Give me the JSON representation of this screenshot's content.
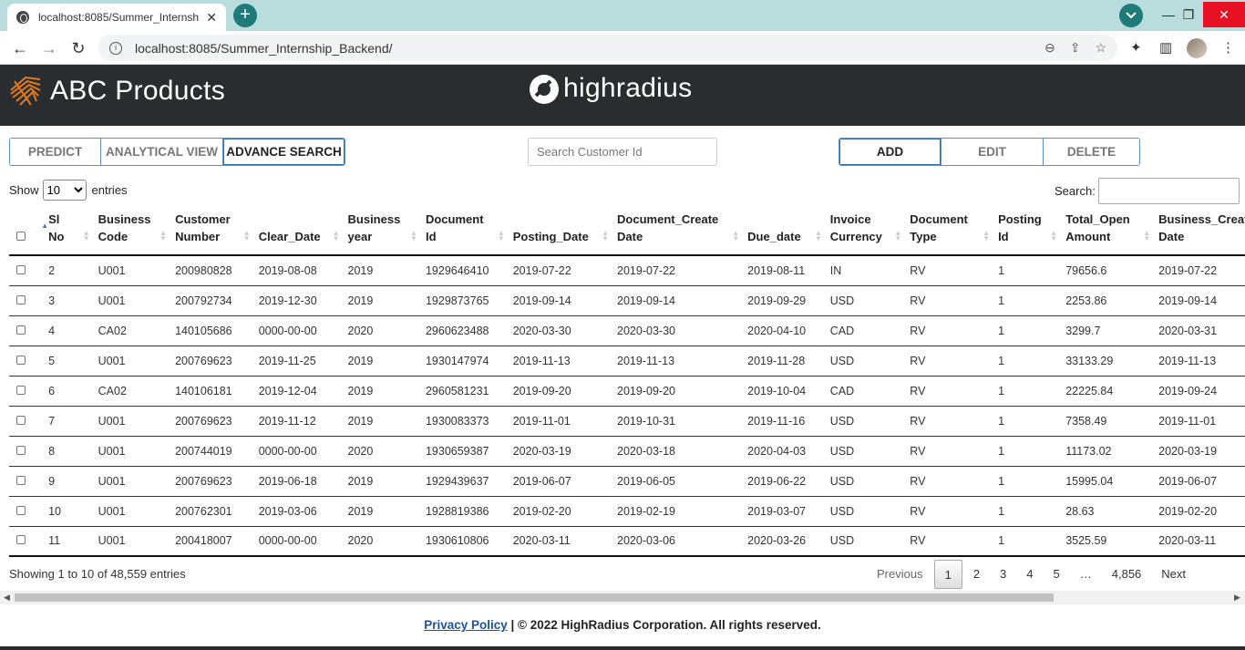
{
  "browser": {
    "tab_title": "localhost:8085/Summer_Internsh",
    "new_tab": "+",
    "tab_close": "✕",
    "url": "localhost:8085/Summer_Internship_Backend/",
    "window_controls": {
      "minimize": "—",
      "maximize": "❐",
      "close": "✕"
    }
  },
  "header": {
    "app_title": "ABC Products",
    "brand": "highradius",
    "colors": {
      "bar": "#2a2d2f",
      "logo_accent": "#e07a22"
    }
  },
  "left_buttons": [
    {
      "label": "PREDICT"
    },
    {
      "label": "ANALYTICAL VIEW"
    },
    {
      "label": "ADVANCE SEARCH"
    }
  ],
  "search": {
    "placeholder": "Search Customer Id"
  },
  "right_buttons": [
    {
      "label": "ADD"
    },
    {
      "label": "EDIT"
    },
    {
      "label": "DELETE"
    }
  ],
  "length_menu": {
    "prefix": "Show",
    "value": "10",
    "suffix": "entries"
  },
  "filter": {
    "label": "Search:"
  },
  "table": {
    "columns": [
      {
        "label": "Sl\nNo"
      },
      {
        "label": "Business\nCode"
      },
      {
        "label": "Customer\nNumber"
      },
      {
        "label": "Clear_Date"
      },
      {
        "label": "Business\nyear"
      },
      {
        "label": "Document\nId"
      },
      {
        "label": "Posting_Date"
      },
      {
        "label": "Document_Create\nDate"
      },
      {
        "label": "Due_date"
      },
      {
        "label": "Invoice\nCurrency"
      },
      {
        "label": "Document\nType"
      },
      {
        "label": "Posting\nId"
      },
      {
        "label": "Total_Open\nAmount"
      },
      {
        "label": "Business_Create\nDate"
      }
    ],
    "rows": [
      [
        "2",
        "U001",
        "200980828",
        "2019-08-08",
        "2019",
        "1929646410",
        "2019-07-22",
        "2019-07-22",
        "2019-08-11",
        "IN",
        "RV",
        "1",
        "79656.6",
        "2019-07-22"
      ],
      [
        "3",
        "U001",
        "200792734",
        "2019-12-30",
        "2019",
        "1929873765",
        "2019-09-14",
        "2019-09-14",
        "2019-09-29",
        "USD",
        "RV",
        "1",
        "2253.86",
        "2019-09-14"
      ],
      [
        "4",
        "CA02",
        "140105686",
        "0000-00-00",
        "2020",
        "2960623488",
        "2020-03-30",
        "2020-03-30",
        "2020-04-10",
        "CAD",
        "RV",
        "1",
        "3299.7",
        "2020-03-31"
      ],
      [
        "5",
        "U001",
        "200769623",
        "2019-11-25",
        "2019",
        "1930147974",
        "2019-11-13",
        "2019-11-13",
        "2019-11-28",
        "USD",
        "RV",
        "1",
        "33133.29",
        "2019-11-13"
      ],
      [
        "6",
        "CA02",
        "140106181",
        "2019-12-04",
        "2019",
        "2960581231",
        "2019-09-20",
        "2019-09-20",
        "2019-10-04",
        "CAD",
        "RV",
        "1",
        "22225.84",
        "2019-09-24"
      ],
      [
        "7",
        "U001",
        "200769623",
        "2019-11-12",
        "2019",
        "1930083373",
        "2019-11-01",
        "2019-10-31",
        "2019-11-16",
        "USD",
        "RV",
        "1",
        "7358.49",
        "2019-11-01"
      ],
      [
        "8",
        "U001",
        "200744019",
        "0000-00-00",
        "2020",
        "1930659387",
        "2020-03-19",
        "2020-03-18",
        "2020-04-03",
        "USD",
        "RV",
        "1",
        "11173.02",
        "2020-03-19"
      ],
      [
        "9",
        "U001",
        "200769623",
        "2019-06-18",
        "2019",
        "1929439637",
        "2019-06-07",
        "2019-06-05",
        "2019-06-22",
        "USD",
        "RV",
        "1",
        "15995.04",
        "2019-06-07"
      ],
      [
        "10",
        "U001",
        "200762301",
        "2019-03-06",
        "2019",
        "1928819386",
        "2019-02-20",
        "2019-02-19",
        "2019-03-07",
        "USD",
        "RV",
        "1",
        "28.63",
        "2019-02-20"
      ],
      [
        "11",
        "U001",
        "200418007",
        "0000-00-00",
        "2020",
        "1930610806",
        "2020-03-11",
        "2020-03-06",
        "2020-03-26",
        "USD",
        "RV",
        "1",
        "3525.59",
        "2020-03-11"
      ]
    ]
  },
  "info": "Showing 1 to 10 of 48,559 entries",
  "pagination": {
    "previous": "Previous",
    "pages": [
      "1",
      "2",
      "3",
      "4",
      "5",
      "…",
      "4,856"
    ],
    "current": "1",
    "next": "Next"
  },
  "footer": {
    "link": "Privacy Policy",
    "text": " | © 2022 HighRadius Corporation. All rights reserved."
  }
}
